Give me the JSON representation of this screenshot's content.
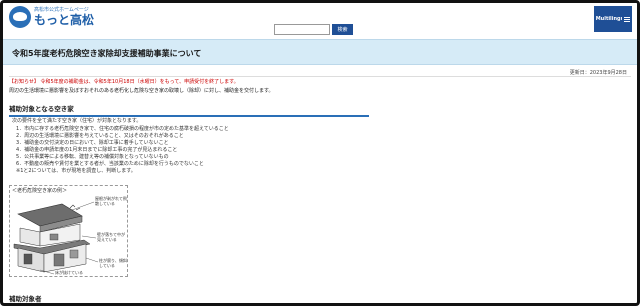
{
  "header": {
    "logo_small": "高松市公式ホームページ",
    "logo_main": "もっと高松",
    "search_placeholder": "",
    "search_button": "検索",
    "multilingual": "Multilingual"
  },
  "page_title": "令和5年度老朽危険空き家除却支援補助事業について",
  "updated": "更新日：2023年9月28日",
  "notice": {
    "red": "【お知らせ】 令和5年度の補助金は、令和5年10月18日（水曜日）をもって、申請受付を終了します。",
    "black": "周辺の生活環境に悪影響を及ぼすおそれのある老朽化し危険な空き家の取壊し（除却）に対し、補助金を交付します。"
  },
  "section1": {
    "heading": "補助対象となる空き家",
    "intro": "次の要件を全て満たす空き家（住宅）が対象となります。",
    "criteria": [
      "1．市内に存する老朽危険空き家で、住宅の腐朽破損の程度が市の定めた基準を超えていること",
      "2．周辺の生活環境に悪影響を与えていること、又はそのおそれがあること",
      "3．補助金の交付決定の日において、除却工事に着手していないこと",
      "4．補助金の申請年度の1月末日までに除却工事の完了が見込まれること",
      "5．公共事業等による移転、建替え等の補償対象となっていないもの",
      "6．不動産の販売や賃付を業とする者が、当該業のために除却を行うものでないこと"
    ],
    "footnote": "※1と2については、市が現地を調査し、判断します。"
  },
  "figure": {
    "caption": "＜老朽危険空き家の例＞",
    "labels": [
      "屋根が剥がれて飛散している",
      "壁が落ちて中が見えている",
      "床が抜けている",
      "柱が腐り、傾斜している"
    ]
  },
  "section2": {
    "heading": "補助対象者"
  }
}
